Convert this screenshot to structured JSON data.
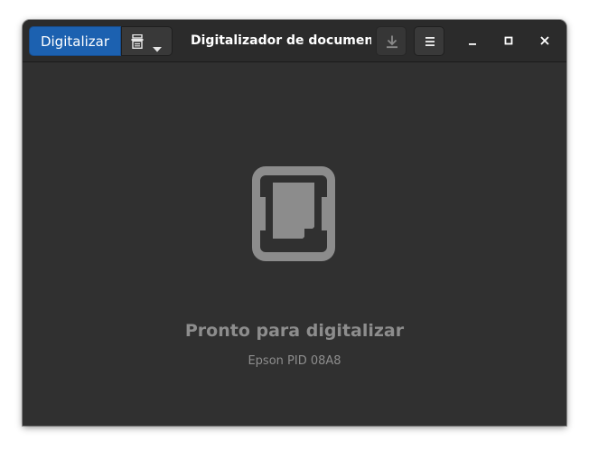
{
  "headerbar": {
    "scan_label": "Digitalizar",
    "title": "Digitalizador de document...",
    "scan_type_icon": "document-scan-icon",
    "scan_type_menu_icon": "caret-down-icon",
    "save_icon": "download-icon",
    "menu_icon": "hamburger-menu-icon",
    "window_controls": [
      "minimize-icon",
      "maximize-icon",
      "close-icon"
    ]
  },
  "status": {
    "icon": "scanner-document-icon",
    "title": "Pronto para digitalizar",
    "detail": "Epson PID 08A8"
  },
  "colors": {
    "accent": "#1c61b0",
    "window_bg": "#303030",
    "headerbar_bg": "#2b2b2b",
    "status_text": "#8d8d8d"
  }
}
